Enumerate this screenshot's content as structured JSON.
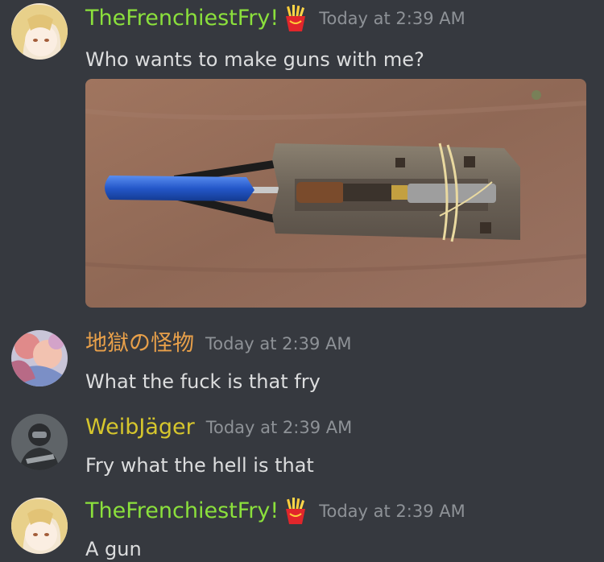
{
  "messages": [
    {
      "author": "TheFrenchiestFry!",
      "author_color": "#8be03c",
      "timestamp": "Today at 2:39 AM",
      "text": "Who wants to make guns with me?",
      "badge_icon": "fries-icon"
    },
    {
      "author": "地獄の怪物",
      "author_color": "#e8a04a",
      "timestamp": "Today at 2:39 AM",
      "text": "What the fuck is that fry"
    },
    {
      "author": "WeibJäger",
      "author_color": "#d6c62d",
      "timestamp": "Today at 2:39 AM",
      "text": "Fry what the hell is that"
    },
    {
      "author": "TheFrenchiestFry!",
      "author_color": "#8be03c",
      "timestamp": "Today at 2:39 AM",
      "text": "A gun",
      "badge_icon": "fries-icon"
    }
  ],
  "colors": {
    "background": "#36393f",
    "message_text": "#dcddde",
    "timestamp": "#8e9297"
  }
}
